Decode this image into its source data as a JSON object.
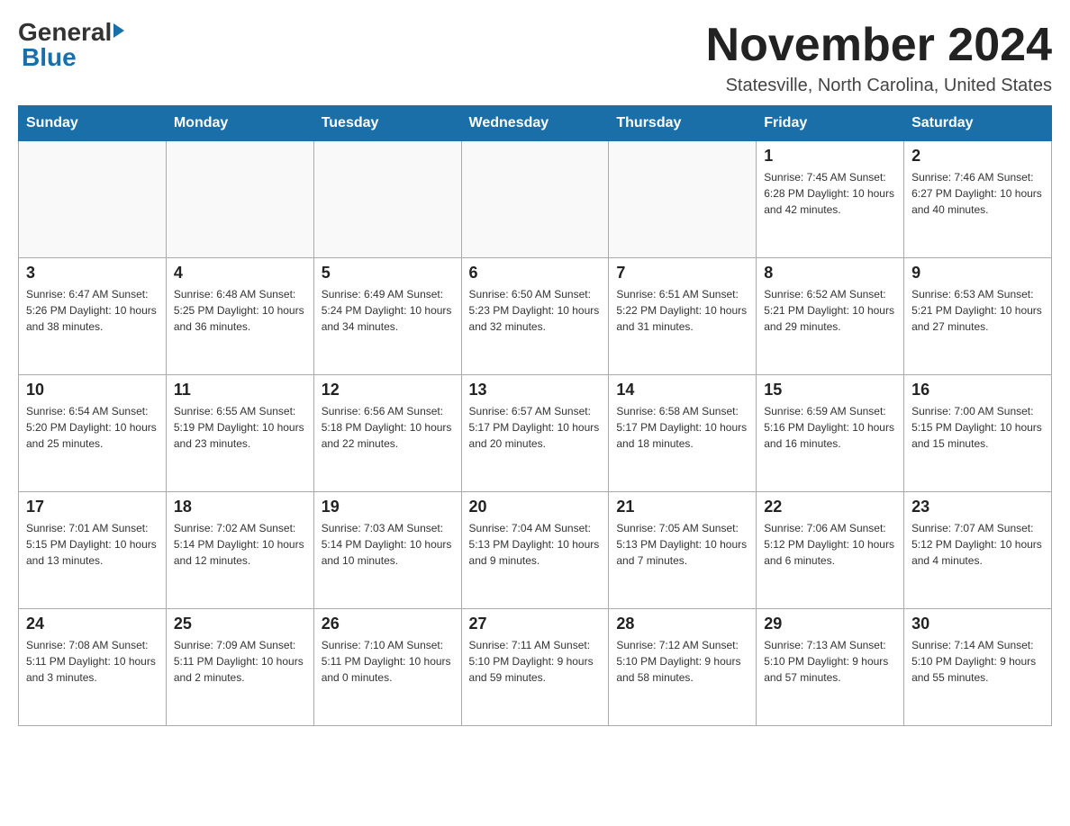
{
  "logo": {
    "general": "General",
    "blue": "Blue"
  },
  "header": {
    "month": "November 2024",
    "location": "Statesville, North Carolina, United States"
  },
  "weekdays": [
    "Sunday",
    "Monday",
    "Tuesday",
    "Wednesday",
    "Thursday",
    "Friday",
    "Saturday"
  ],
  "weeks": [
    [
      {
        "day": "",
        "info": ""
      },
      {
        "day": "",
        "info": ""
      },
      {
        "day": "",
        "info": ""
      },
      {
        "day": "",
        "info": ""
      },
      {
        "day": "",
        "info": ""
      },
      {
        "day": "1",
        "info": "Sunrise: 7:45 AM\nSunset: 6:28 PM\nDaylight: 10 hours and 42 minutes."
      },
      {
        "day": "2",
        "info": "Sunrise: 7:46 AM\nSunset: 6:27 PM\nDaylight: 10 hours and 40 minutes."
      }
    ],
    [
      {
        "day": "3",
        "info": "Sunrise: 6:47 AM\nSunset: 5:26 PM\nDaylight: 10 hours and 38 minutes."
      },
      {
        "day": "4",
        "info": "Sunrise: 6:48 AM\nSunset: 5:25 PM\nDaylight: 10 hours and 36 minutes."
      },
      {
        "day": "5",
        "info": "Sunrise: 6:49 AM\nSunset: 5:24 PM\nDaylight: 10 hours and 34 minutes."
      },
      {
        "day": "6",
        "info": "Sunrise: 6:50 AM\nSunset: 5:23 PM\nDaylight: 10 hours and 32 minutes."
      },
      {
        "day": "7",
        "info": "Sunrise: 6:51 AM\nSunset: 5:22 PM\nDaylight: 10 hours and 31 minutes."
      },
      {
        "day": "8",
        "info": "Sunrise: 6:52 AM\nSunset: 5:21 PM\nDaylight: 10 hours and 29 minutes."
      },
      {
        "day": "9",
        "info": "Sunrise: 6:53 AM\nSunset: 5:21 PM\nDaylight: 10 hours and 27 minutes."
      }
    ],
    [
      {
        "day": "10",
        "info": "Sunrise: 6:54 AM\nSunset: 5:20 PM\nDaylight: 10 hours and 25 minutes."
      },
      {
        "day": "11",
        "info": "Sunrise: 6:55 AM\nSunset: 5:19 PM\nDaylight: 10 hours and 23 minutes."
      },
      {
        "day": "12",
        "info": "Sunrise: 6:56 AM\nSunset: 5:18 PM\nDaylight: 10 hours and 22 minutes."
      },
      {
        "day": "13",
        "info": "Sunrise: 6:57 AM\nSunset: 5:17 PM\nDaylight: 10 hours and 20 minutes."
      },
      {
        "day": "14",
        "info": "Sunrise: 6:58 AM\nSunset: 5:17 PM\nDaylight: 10 hours and 18 minutes."
      },
      {
        "day": "15",
        "info": "Sunrise: 6:59 AM\nSunset: 5:16 PM\nDaylight: 10 hours and 16 minutes."
      },
      {
        "day": "16",
        "info": "Sunrise: 7:00 AM\nSunset: 5:15 PM\nDaylight: 10 hours and 15 minutes."
      }
    ],
    [
      {
        "day": "17",
        "info": "Sunrise: 7:01 AM\nSunset: 5:15 PM\nDaylight: 10 hours and 13 minutes."
      },
      {
        "day": "18",
        "info": "Sunrise: 7:02 AM\nSunset: 5:14 PM\nDaylight: 10 hours and 12 minutes."
      },
      {
        "day": "19",
        "info": "Sunrise: 7:03 AM\nSunset: 5:14 PM\nDaylight: 10 hours and 10 minutes."
      },
      {
        "day": "20",
        "info": "Sunrise: 7:04 AM\nSunset: 5:13 PM\nDaylight: 10 hours and 9 minutes."
      },
      {
        "day": "21",
        "info": "Sunrise: 7:05 AM\nSunset: 5:13 PM\nDaylight: 10 hours and 7 minutes."
      },
      {
        "day": "22",
        "info": "Sunrise: 7:06 AM\nSunset: 5:12 PM\nDaylight: 10 hours and 6 minutes."
      },
      {
        "day": "23",
        "info": "Sunrise: 7:07 AM\nSunset: 5:12 PM\nDaylight: 10 hours and 4 minutes."
      }
    ],
    [
      {
        "day": "24",
        "info": "Sunrise: 7:08 AM\nSunset: 5:11 PM\nDaylight: 10 hours and 3 minutes."
      },
      {
        "day": "25",
        "info": "Sunrise: 7:09 AM\nSunset: 5:11 PM\nDaylight: 10 hours and 2 minutes."
      },
      {
        "day": "26",
        "info": "Sunrise: 7:10 AM\nSunset: 5:11 PM\nDaylight: 10 hours and 0 minutes."
      },
      {
        "day": "27",
        "info": "Sunrise: 7:11 AM\nSunset: 5:10 PM\nDaylight: 9 hours and 59 minutes."
      },
      {
        "day": "28",
        "info": "Sunrise: 7:12 AM\nSunset: 5:10 PM\nDaylight: 9 hours and 58 minutes."
      },
      {
        "day": "29",
        "info": "Sunrise: 7:13 AM\nSunset: 5:10 PM\nDaylight: 9 hours and 57 minutes."
      },
      {
        "day": "30",
        "info": "Sunrise: 7:14 AM\nSunset: 5:10 PM\nDaylight: 9 hours and 55 minutes."
      }
    ]
  ]
}
